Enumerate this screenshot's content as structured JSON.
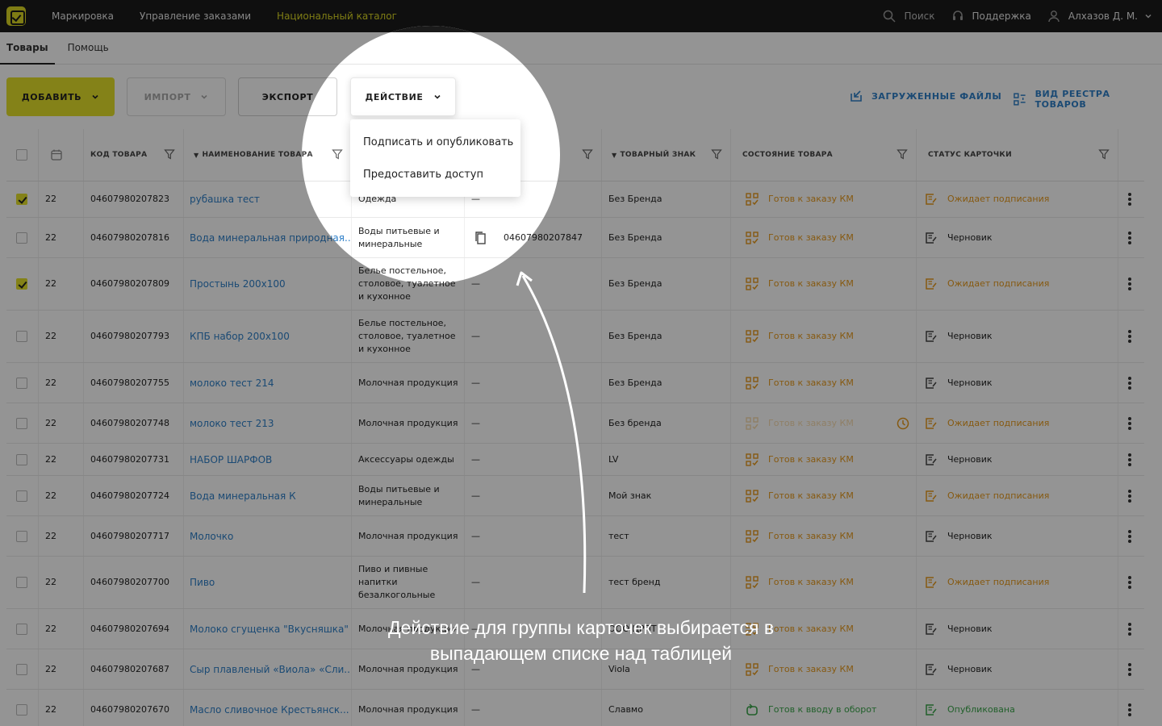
{
  "topbar": {
    "nav": [
      "Маркировка",
      "Управление заказами",
      "Национальный каталог"
    ],
    "search": "Поиск",
    "support": "Поддержка",
    "user": "Алхазов Д. М."
  },
  "subtabs": [
    "Товары",
    "Помощь"
  ],
  "toolbar": {
    "add": "ДОБАВИТЬ",
    "import": "ИМПОРТ",
    "export": "ЭКСПОРТ",
    "action": "ДЕЙСТВИЕ",
    "files": "ЗАГРУЖЕННЫЕ ФАЙЛЫ",
    "registry": "ВИД РЕЕСТРА ТОВАРОВ"
  },
  "dropdown": [
    "Подписать и опубликовать",
    "Предоставить доступ"
  ],
  "columns": {
    "code": "КОД ТОВАРА",
    "name": "НАИМЕНОВАНИЕ ТОВАРА",
    "brand": "ТОВАРНЫЙ ЗНАК",
    "state": "СОСТОЯНИЕ ТОВАРА",
    "card": "СТАТУС КАРТОЧКИ"
  },
  "rows": [
    {
      "date": "22",
      "code": "04607980207823",
      "name": "рубашка тест",
      "cat": "Одежда",
      "gtin": "—",
      "brand": "Без Бренда",
      "state": "Готов к заказу КМ",
      "card": "Ожидает подписания",
      "checked": true
    },
    {
      "date": "22",
      "code": "04607980207816",
      "name": "Вода минеральная природная...",
      "cat": "Воды питьевые и минеральные",
      "gtin": "04607980207847",
      "brand": "Без Бренда",
      "state": "Готов к заказу КМ",
      "card": "Черновик",
      "checked": false
    },
    {
      "date": "22",
      "code": "04607980207809",
      "name": "Простынь 200х100",
      "cat": "Белье постельное, столовое, туалетное и кухонное",
      "gtin": "—",
      "brand": "Без Бренда",
      "state": "Готов к заказу КМ",
      "card": "Ожидает подписания",
      "checked": true
    },
    {
      "date": "22",
      "code": "04607980207793",
      "name": "КПБ набор 200х100",
      "cat": "Белье постельное, столовое, туалетное и кухонное",
      "gtin": "—",
      "brand": "Без Бренда",
      "state": "Готов к заказу КМ",
      "card": "Черновик",
      "checked": false
    },
    {
      "date": "22",
      "code": "04607980207755",
      "name": "молоко тест 214",
      "cat": "Молочная продукция",
      "gtin": "—",
      "brand": "Без Бренда",
      "state": "Готов к заказу КМ",
      "card": "Черновик",
      "checked": false
    },
    {
      "date": "22",
      "code": "04607980207748",
      "name": "молоко тест 213",
      "cat": "Молочная продукция",
      "gtin": "—",
      "brand": "Без бренда",
      "state": "Готов к заказу КМ",
      "card": "Ожидает подписания",
      "checked": false
    },
    {
      "date": "22",
      "code": "04607980207731",
      "name": "НАБОР ШАРФОВ",
      "cat": "Аксессуары одежды",
      "gtin": "—",
      "brand": "LV",
      "state": "Готов к заказу КМ",
      "card": "Черновик",
      "checked": false
    },
    {
      "date": "22",
      "code": "04607980207724",
      "name": "Вода минеральная К",
      "cat": "Воды питьевые и минеральные",
      "gtin": "—",
      "brand": "Мой знак",
      "state": "Готов к заказу КМ",
      "card": "Ожидает подписания",
      "checked": false
    },
    {
      "date": "22",
      "code": "04607980207717",
      "name": "Молочко",
      "cat": "Молочная продукция",
      "gtin": "—",
      "brand": "тест",
      "state": "Готов к заказу КМ",
      "card": "Черновик",
      "checked": false
    },
    {
      "date": "22",
      "code": "04607980207700",
      "name": "Пиво",
      "cat": "Пиво и пивные напитки безалкогольные",
      "gtin": "—",
      "brand": "тест бренд",
      "state": "Готов к заказу КМ",
      "card": "Ожидает подписания",
      "checked": false
    },
    {
      "date": "22",
      "code": "04607980207694",
      "name": "Молоко сгущенка \"Вкусняшка\"",
      "cat": "Молочная продукция",
      "gtin": "—",
      "brand": "ООО ЦРПТ",
      "state": "Готов к заказу КМ",
      "card": "Черновик",
      "checked": false
    },
    {
      "date": "22",
      "code": "04607980207687",
      "name": "Сыр плавленый «Виола» «Сли...",
      "cat": "Молочная продукция",
      "gtin": "—",
      "brand": "Viola",
      "state": "Готов к заказу КМ",
      "card": "Черновик",
      "checked": false
    },
    {
      "date": "22",
      "code": "04607980207670",
      "name": "Масло сливочное Крестьянск...",
      "cat": "Молочная продукция",
      "gtin": "—",
      "brand": "Славмо",
      "state": "Готов к вводу в оборот",
      "card": "Опубликована",
      "checked": false
    }
  ],
  "caption": "Действие для группы карточек выбирается в выпадающем списке над таблицей"
}
